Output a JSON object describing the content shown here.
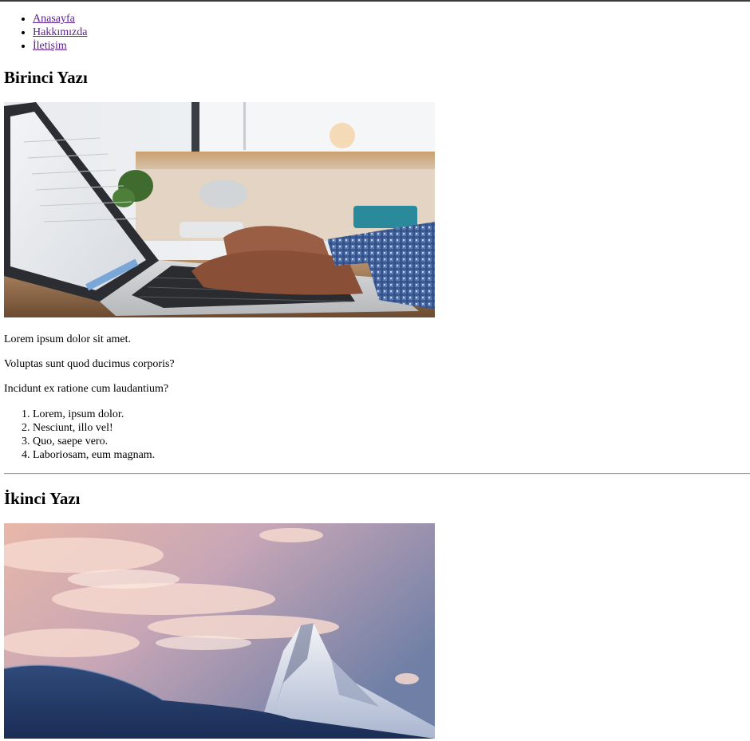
{
  "nav": {
    "items": [
      {
        "label": "Anasayfa"
      },
      {
        "label": "Hakkımızda"
      },
      {
        "label": "İletişim"
      }
    ]
  },
  "posts": [
    {
      "title": "Birinci Yazı",
      "paragraphs": [
        "Lorem ipsum dolor sit amet.",
        "Voluptas sunt quod ducimus corporis?",
        "Incidunt ex ratione cum laudantium?"
      ],
      "list": [
        "Lorem, ipsum dolor.",
        "Nesciunt, illo vel!",
        "Quo, saepe vero.",
        "Laboriosam, eum magnam."
      ]
    },
    {
      "title": "İkinci Yazı"
    }
  ],
  "colors": {
    "link_visited": "#5a1f8a",
    "top_border": "#3a3a3a",
    "separator": "#9a9a9a"
  }
}
